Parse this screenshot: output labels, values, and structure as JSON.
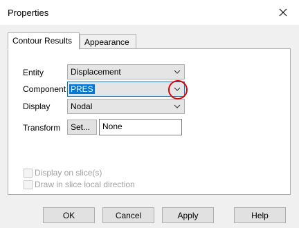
{
  "window": {
    "title": "Properties"
  },
  "tabs": [
    {
      "label": "Contour Results",
      "active": true
    },
    {
      "label": "Appearance",
      "active": false
    }
  ],
  "fields": {
    "entity": {
      "label": "Entity",
      "value": "Displacement"
    },
    "component": {
      "label": "Component",
      "value": "PRES"
    },
    "display": {
      "label": "Display",
      "value": "Nodal"
    },
    "transform": {
      "label": "Transform",
      "set_label": "Set...",
      "value": "None"
    }
  },
  "options": {
    "display_on_slice": {
      "label": "Display on slice(s)",
      "checked": false,
      "enabled": false
    },
    "draw_slice_local": {
      "label": "Draw in slice local direction",
      "checked": false,
      "enabled": false
    }
  },
  "buttons": {
    "ok": "OK",
    "cancel": "Cancel",
    "apply": "Apply",
    "help": "Help"
  },
  "colors": {
    "annotation": "#e00000",
    "focus": "#0078d7"
  },
  "icons": {
    "close": "close-icon",
    "dropdown": "chevron-down-icon"
  }
}
